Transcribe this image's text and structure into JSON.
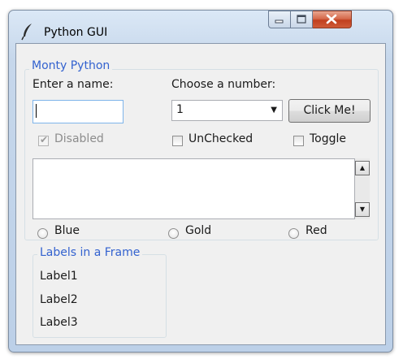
{
  "window": {
    "title": "Python GUI"
  },
  "frame": {
    "title": "Monty Python",
    "name_label": "Enter a name:",
    "name_value": "",
    "number_label": "Choose a number:",
    "number_value": "1",
    "button_label": "Click Me!",
    "checkboxes": [
      {
        "label": "Disabled",
        "checked": true,
        "enabled": false
      },
      {
        "label": "UnChecked",
        "checked": false,
        "enabled": true
      },
      {
        "label": "Toggle",
        "checked": false,
        "enabled": true
      }
    ],
    "scrolled_text": "",
    "radios": [
      {
        "label": "Blue",
        "selected": false
      },
      {
        "label": "Gold",
        "selected": false
      },
      {
        "label": "Red",
        "selected": false
      }
    ]
  },
  "labels_frame": {
    "title": "Labels in a Frame",
    "labels": [
      "Label1",
      "Label2",
      "Label3"
    ]
  },
  "colors": {
    "frame_title": "#3362cf",
    "client_bg": "#f0f0f0",
    "close_button": "#c1401f"
  }
}
